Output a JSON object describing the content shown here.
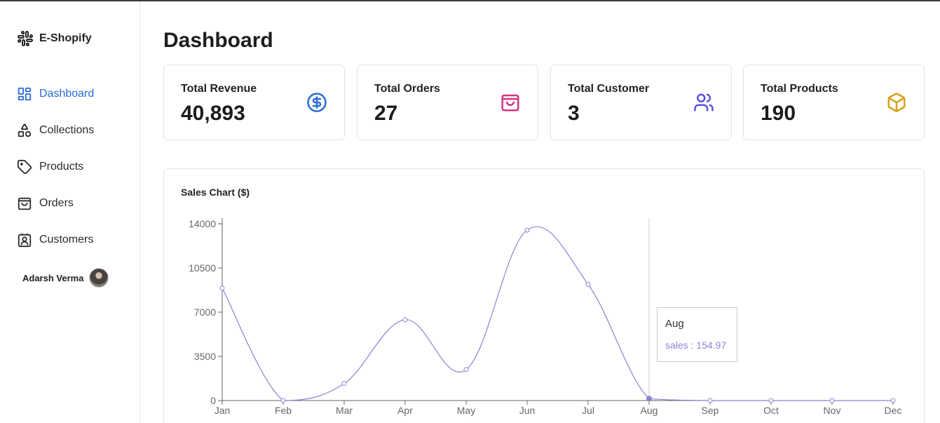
{
  "brand": {
    "name": "E-Shopify",
    "icon": "slack-logo-icon"
  },
  "sidebar": {
    "items": [
      {
        "label": "Dashboard",
        "icon": "dashboard-grid-icon",
        "active": true
      },
      {
        "label": "Collections",
        "icon": "shapes-icon",
        "active": false
      },
      {
        "label": "Products",
        "icon": "tag-icon",
        "active": false
      },
      {
        "label": "Orders",
        "icon": "shopping-bag-icon",
        "active": false
      },
      {
        "label": "Customers",
        "icon": "contact-card-icon",
        "active": false
      }
    ],
    "user": {
      "name": "Adarsh Verma"
    }
  },
  "main": {
    "title": "Dashboard",
    "cards": [
      {
        "title": "Total Revenue",
        "value": "40,893",
        "icon": "dollar-circle-icon",
        "color": "#2b6ad6"
      },
      {
        "title": "Total Orders",
        "value": "27",
        "icon": "shopping-bag-icon",
        "color": "#d63384"
      },
      {
        "title": "Total Customer",
        "value": "3",
        "icon": "users-icon",
        "color": "#5b4ee0"
      },
      {
        "title": "Total Products",
        "value": "190",
        "icon": "box-icon",
        "color": "#d4a017"
      }
    ]
  },
  "colors": {
    "accent": "#2b6ad6",
    "line": "#8884d8",
    "border": "#e3e3e3"
  },
  "chart": {
    "title": "Sales Chart ($)",
    "tooltip": {
      "label": "Aug",
      "text": "sales : 154.97"
    }
  },
  "chart_data": {
    "type": "line",
    "title": "Sales Chart ($)",
    "categories": [
      "Jan",
      "Feb",
      "Mar",
      "Apr",
      "May",
      "Jun",
      "Jul",
      "Aug",
      "Sep",
      "Oct",
      "Nov",
      "Dec"
    ],
    "series": [
      {
        "name": "sales",
        "values": [
          8900,
          0,
          1350,
          6400,
          2450,
          13500,
          9200,
          154.97,
          0,
          0,
          0,
          0
        ]
      }
    ],
    "ylim": [
      0,
      14000
    ],
    "yticks": [
      0,
      3500,
      7000,
      10500,
      14000
    ],
    "grid": false,
    "active_category": "Aug"
  }
}
